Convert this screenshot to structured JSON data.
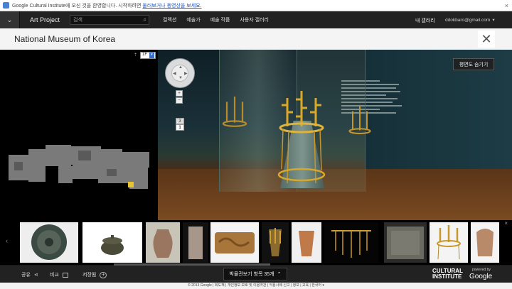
{
  "notice": {
    "text": "Google Cultural Institute에 오신 것을 환영합니다. 시작하려면",
    "link": "둘러보거나 동영상을 보세요.",
    "close": "×"
  },
  "topbar": {
    "menu_icon": "chevron-down-icon",
    "brand": "Art Project",
    "search_placeholder": "검색",
    "nav": [
      "컬렉션",
      "예술가",
      "예술 작품",
      "사용자 갤러리"
    ],
    "my_gallery": "내 갤러리",
    "account": "ddokbaro@gmail.com"
  },
  "title": "National Museum of Korea",
  "viewer": {
    "floor": "1F",
    "hide_map": "평면도 숨기기",
    "zoom_in": "+",
    "zoom_out": "−",
    "levels": [
      "3",
      "1"
    ]
  },
  "strip": {
    "scroll_prev": "‹",
    "close": "×"
  },
  "bottombar": {
    "share": "공유",
    "compare": "비교",
    "save": "저장됨",
    "count": "박물관보기 항목 35개",
    "brand_line1": "CULTURAL",
    "brand_line2": "INSTITUTE",
    "powered_by": "powered by",
    "google": "Google"
  },
  "footer": "© 2013 Google | 회도책 | 개인정보 보호 및 이용약관 | 악용사례 신고 | 정보 | 교육 | 한국어 ▾"
}
